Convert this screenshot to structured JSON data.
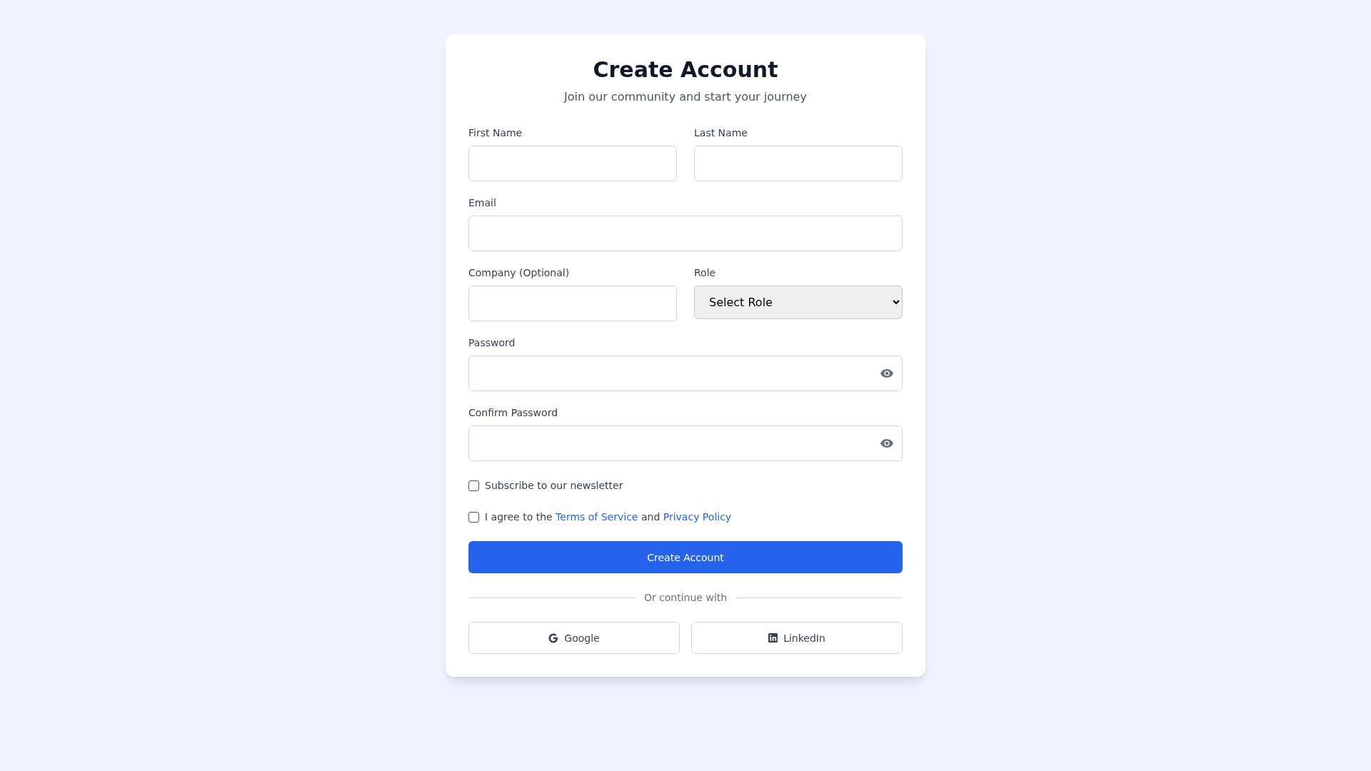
{
  "header": {
    "title": "Create Account",
    "subtitle": "Join our community and start your journey"
  },
  "rows": [
    {
      "fields": [
        {
          "label": "First Name",
          "kind": "text"
        },
        {
          "label": "Last Name",
          "kind": "text"
        }
      ]
    },
    {
      "fields": [
        {
          "label": "Email",
          "kind": "text"
        }
      ]
    },
    {
      "fields": [
        {
          "label": "Company (Optional)",
          "kind": "text"
        },
        {
          "label": "Role",
          "kind": "select",
          "value": "Select Role"
        }
      ]
    },
    {
      "fields": [
        {
          "label": "Password",
          "kind": "password"
        }
      ]
    },
    {
      "fields": [
        {
          "label": "Confirm Password",
          "kind": "password"
        }
      ]
    }
  ],
  "checkboxes": [
    {
      "text": "Subscribe to our newsletter",
      "checked": false
    },
    {
      "text": "I agree to the",
      "checked": false,
      "links": [
        {
          "text": "Terms of Service"
        },
        {
          "joiner": "and"
        },
        {
          "text": "Privacy Policy"
        }
      ]
    }
  ],
  "submit": "Create Account",
  "divider": "Or continue with",
  "social": [
    {
      "label": "Google",
      "kind": "google"
    },
    {
      "label": "LinkedIn",
      "kind": "linkedin"
    }
  ]
}
